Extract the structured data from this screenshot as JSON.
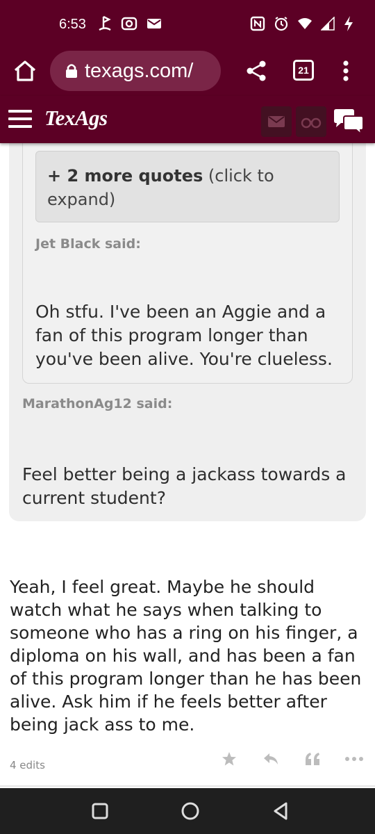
{
  "status_bar": {
    "time": "6:53",
    "left_icons": [
      "golf-icon",
      "instagram-icon",
      "mail-icon"
    ],
    "right_icons": [
      "nfc-icon",
      "alarm-icon",
      "wifi-icon",
      "signal-icon",
      "charging-icon"
    ]
  },
  "browser": {
    "url": "texags.com/",
    "tab_count": "21"
  },
  "header": {
    "logo": "TexAgs"
  },
  "thread": {
    "more_quotes_bold": "+ 2 more quotes",
    "more_quotes_rest": " (click to expand)",
    "inner_author": "Jet Black said:",
    "inner_text": "Oh stfu. I've been an Aggie and a fan of this program longer than you've been alive. You're clueless.",
    "outer_author": "MarathonAg12 said:",
    "outer_text": "Feel better being a jackass towards a current student?",
    "post_text": "Yeah, I feel great. Maybe he should watch what he says when talking to someone who has a ring on his finger, a diploma on his wall, and has been a fan of this program longer than he has been alive. Ask him if he feels better after being jack ass to me.",
    "edits": "4 edits"
  },
  "colors": {
    "brand": "#5c0025",
    "url_box": "#7a2547",
    "quote_bg": "#efefef"
  }
}
